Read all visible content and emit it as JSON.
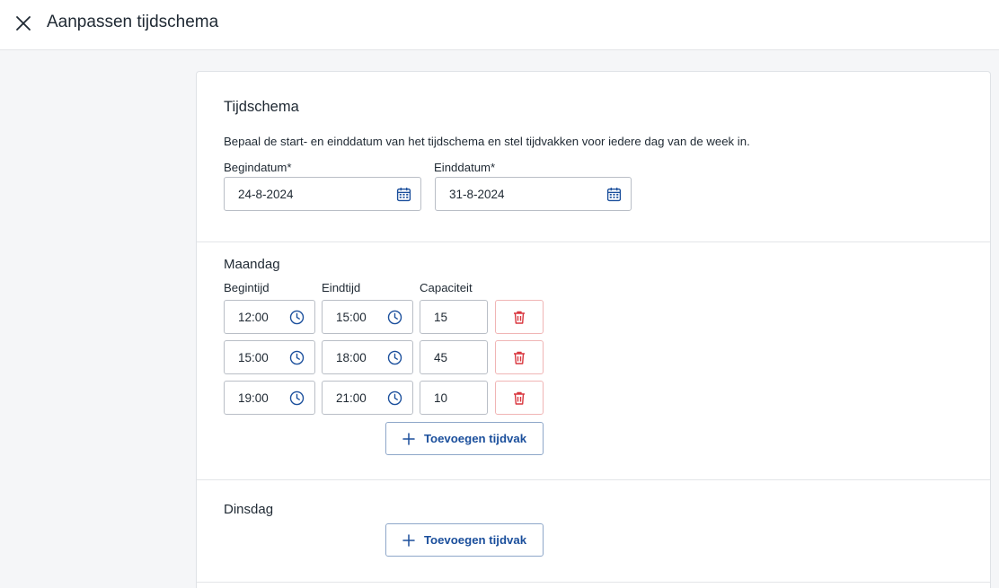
{
  "header": {
    "title": "Aanpassen tijdschema"
  },
  "schedule": {
    "title": "Tijdschema",
    "description": "Bepaal de start- en einddatum van het tijdschema en stel tijdvakken voor iedere dag van de week in.",
    "start_label": "Begindatum",
    "end_label": "Einddatum",
    "required_mark": "*",
    "start_value": "24-8-2024",
    "end_value": "31-8-2024"
  },
  "days": [
    {
      "name": "Maandag",
      "col_begin": "Begintijd",
      "col_end": "Eindtijd",
      "col_capacity": "Capaciteit",
      "slots": [
        {
          "begin": "12:00",
          "end": "15:00",
          "capacity": "15"
        },
        {
          "begin": "15:00",
          "end": "18:00",
          "capacity": "45"
        },
        {
          "begin": "19:00",
          "end": "21:00",
          "capacity": "10"
        }
      ],
      "add_label": "Toevoegen tijdvak"
    },
    {
      "name": "Dinsdag",
      "add_label": "Toevoegen tijdvak"
    }
  ],
  "colors": {
    "accent": "#1b4f9c",
    "danger": "#d9363e",
    "border": "#b9bec6"
  },
  "icons": {
    "close": "close-icon",
    "calendar": "calendar-icon",
    "clock": "clock-icon",
    "trash": "trash-icon",
    "plus": "plus-icon"
  }
}
